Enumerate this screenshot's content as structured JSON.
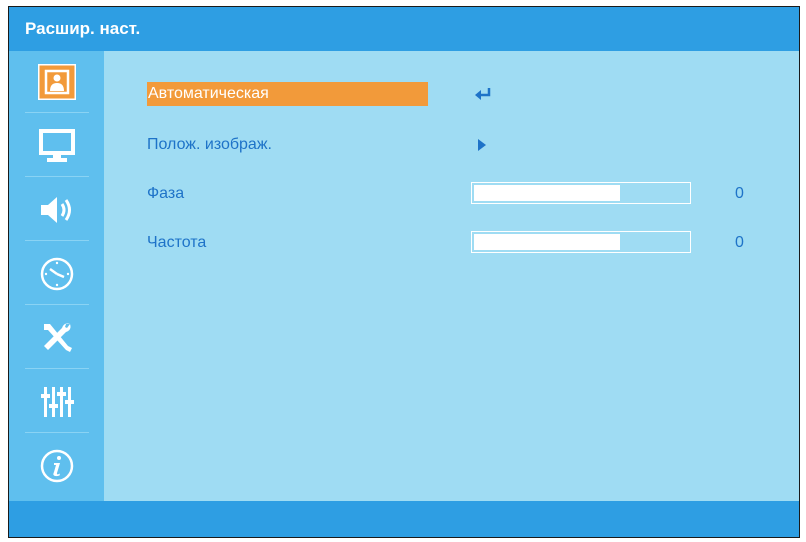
{
  "header": {
    "title": "Расшир. наст."
  },
  "sidebar": {
    "items": [
      {
        "icon": "image-settings-icon",
        "selected": true
      },
      {
        "icon": "monitor-icon",
        "selected": false
      },
      {
        "icon": "speaker-icon",
        "selected": false
      },
      {
        "icon": "clock-icon",
        "selected": false
      },
      {
        "icon": "tools-icon",
        "selected": false
      },
      {
        "icon": "equalizer-icon",
        "selected": false
      },
      {
        "icon": "info-icon",
        "selected": false
      }
    ]
  },
  "menu": {
    "auto": {
      "label": "Автоматическая",
      "icon": "enter-icon"
    },
    "position": {
      "label": "Полож. изображ.",
      "icon": "arrow-right-icon"
    },
    "phase": {
      "label": "Фаза",
      "value": "0",
      "level": 0.68
    },
    "frequency": {
      "label": "Частота",
      "value": "0",
      "level": 0.68
    }
  },
  "colors": {
    "title_bar": "#2e9ee3",
    "panel": "#9fdcf3",
    "sidebar": "#5fbfee",
    "highlight": "#f29a3a",
    "text": "#1e73c8"
  }
}
